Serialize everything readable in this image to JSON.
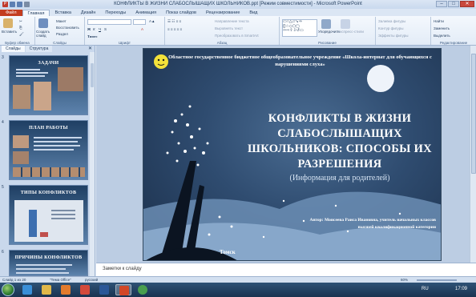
{
  "window": {
    "title": "КОНФЛИКТЫ В ЖИЗНИ СЛАБОСЛЫШАЩИХ ШКОЛЬНИКОВ.ppt [Режим совместимости] - Microsoft PowerPoint"
  },
  "ribbon_tabs": [
    "Файл",
    "Главная",
    "Вставка",
    "Дизайн",
    "Переходы",
    "Анимация",
    "Показ слайдов",
    "Рецензирование",
    "Вид"
  ],
  "ribbon": {
    "clipboard": {
      "paste": "Вставить",
      "label": "Буфер обмена"
    },
    "slides": {
      "new_slide": "Создать слайд",
      "layout": "Макет",
      "reset": "Восстановить",
      "section": "Раздел",
      "label": "Слайды"
    },
    "font": {
      "font_name": "Тимес",
      "label": "Шрифт"
    },
    "paragraph": {
      "text_direction": "Направление текста",
      "align_text": "Выровнять текст",
      "smartart": "Преобразовать в SmartArt",
      "label": "Абзац"
    },
    "drawing": {
      "arrange": "Упорядочить",
      "quick_styles": "Экспресс-стили",
      "fill": "Заливка фигуры",
      "outline": "Контур фигуры",
      "effects": "Эффекты фигуры",
      "label": "Рисование"
    },
    "editing": {
      "find": "Найти",
      "replace": "Заменить",
      "select": "Выделить",
      "label": "Редактирование"
    }
  },
  "left_pane": {
    "tabs": [
      "Слайды",
      "Структура"
    ],
    "slides": [
      {
        "number": "3",
        "title": "ЗАДАЧИ"
      },
      {
        "number": "4",
        "title": "ПЛАН РАБОТЫ"
      },
      {
        "number": "5",
        "title": "ТИПЫ КОНФЛИКТОВ"
      },
      {
        "number": "6",
        "title": "ПРИЧИНЫ КОНФЛИКТОВ"
      }
    ]
  },
  "slide": {
    "header": "Областное государственное бюджетное общеобразовательное учреждение «Школа-интернат для обучающихся с нарушениями слуха»",
    "title": "КОНФЛИКТЫ В ЖИЗНИ СЛАБОСЛЫШАЩИХ ШКОЛЬНИКОВ: СПОСОБЫ ИХ РАЗРЕШЕНИЯ",
    "subtitle": "(Информация для родителей)",
    "author": "Автор: Моисеева Раиса Ивановна, учитель начальных классов высшей квалификационной категории",
    "city": "Томск"
  },
  "notes": {
    "placeholder": "Заметки к слайду"
  },
  "statusbar": {
    "slide_info": "Слайд 1 из 20",
    "theme": "\"Тема Office\"",
    "language": "русский",
    "zoom": "60%"
  },
  "taskbar": {
    "time": "17:09",
    "language": "RU"
  },
  "colors": {
    "file_tab": "#c33d1f",
    "ribbon": "#f4f8fd",
    "slide_bg": "#2f4c70",
    "taskbar": "#1a3350"
  }
}
